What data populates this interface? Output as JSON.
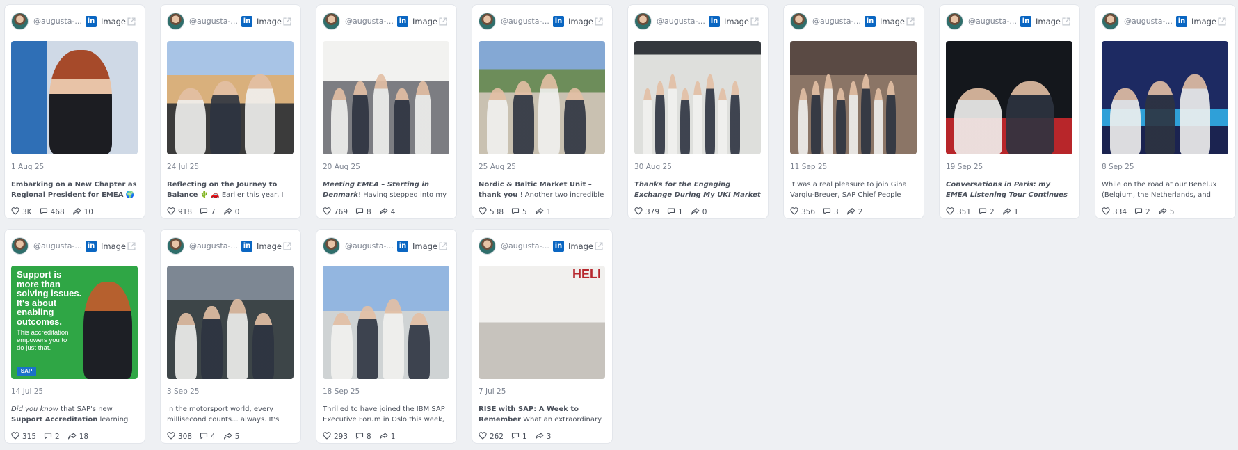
{
  "posts": [
    {
      "handle": "@augusta-...",
      "source": "Image",
      "date": "1 Aug 25",
      "text_html": "<b>Embarking on a New Chapter as Regional President for EMEA</b> 🌍✨ Today marks the beginning",
      "likes": "3K",
      "comments": "468",
      "shares": "10"
    },
    {
      "handle": "@augusta-...",
      "source": "Image",
      "date": "24 Jul 25",
      "text_html": "<b>Reflecting on the Journey to Balance</b> 🌵 🚗 Earlier this year, I joined my",
      "likes": "918",
      "comments": "7",
      "shares": "0"
    },
    {
      "handle": "@augusta-...",
      "source": "Image",
      "date": "20 Aug 25",
      "text_html": "<b><i>Meeting EMEA – Starting in Denmark</i></b>! Having stepped into my new role as",
      "likes": "769",
      "comments": "8",
      "shares": "4"
    },
    {
      "handle": "@augusta-...",
      "source": "Image",
      "date": "25 Aug 25",
      "text_html": "<b>Nordic &amp; Baltic Market Unit – thank you</b> ! Another two incredible stops – Norway",
      "likes": "538",
      "comments": "5",
      "shares": "1"
    },
    {
      "handle": "@augusta-...",
      "source": "Image",
      "date": "30 Aug 25",
      "text_html": "<b><i>Thanks for the Engaging Exchange During My UKI Market Unit Visit</i></b>! This",
      "likes": "379",
      "comments": "1",
      "shares": "0"
    },
    {
      "handle": "@augusta-...",
      "source": "Image",
      "date": "11 Sep 25",
      "text_html": "It was a real pleasure to join Gina Vargiu-Breuer, SAP Chief People",
      "likes": "356",
      "comments": "3",
      "shares": "2"
    },
    {
      "handle": "@augusta-...",
      "source": "Image",
      "date": "19 Sep 25",
      "text_html": "<b><i>Conversations in Paris: my EMEA Listening Tour Continues</i></b> This wasn't the",
      "likes": "351",
      "comments": "2",
      "shares": "1"
    },
    {
      "handle": "@augusta-...",
      "source": "Image",
      "date": "8 Sep 25",
      "text_html": "While on the road at our Benelux (Belgium, the Netherlands, and",
      "likes": "334",
      "comments": "2",
      "shares": "5"
    },
    {
      "handle": "@augusta-...",
      "source": "Image",
      "date": "14 Jul 25",
      "text_html": "<i>Did you know</i> that SAP's new <b>Support Accreditation</b> learning journey is",
      "likes": "315",
      "comments": "2",
      "shares": "18",
      "image_text": {
        "headline": [
          "Support is",
          "more than",
          "solving issues.",
          "It's about",
          "enabling",
          "outcomes."
        ],
        "sub": [
          "This accreditation",
          "empowers you to",
          "do just that."
        ],
        "logo": "SAP"
      }
    },
    {
      "handle": "@augusta-...",
      "source": "Image",
      "date": "3 Sep 25",
      "text_html": "In the motorsport world, every millisecond counts... always. It's almo",
      "likes": "308",
      "comments": "4",
      "shares": "5"
    },
    {
      "handle": "@augusta-...",
      "source": "Image",
      "date": "18 Sep 25",
      "text_html": "Thrilled to have joined the IBM SAP Executive Forum in Oslo this week, an",
      "likes": "293",
      "comments": "8",
      "shares": "1"
    },
    {
      "handle": "@augusta-...",
      "source": "Image",
      "date": "7 Jul 25",
      "text_html": "<b>RISE with SAP: A Week to Remember</b> What an extraordinary week in China",
      "likes": "262",
      "comments": "1",
      "shares": "3",
      "image_text": {
        "sign": "HELI"
      }
    }
  ],
  "icons": {
    "linkedin": "in",
    "external": "external-link-icon",
    "like": "heart-icon",
    "comment": "comment-icon",
    "share": "share-icon"
  },
  "colors": {
    "linkedin": "#0a66c2",
    "accent": "#3a3f4a"
  }
}
